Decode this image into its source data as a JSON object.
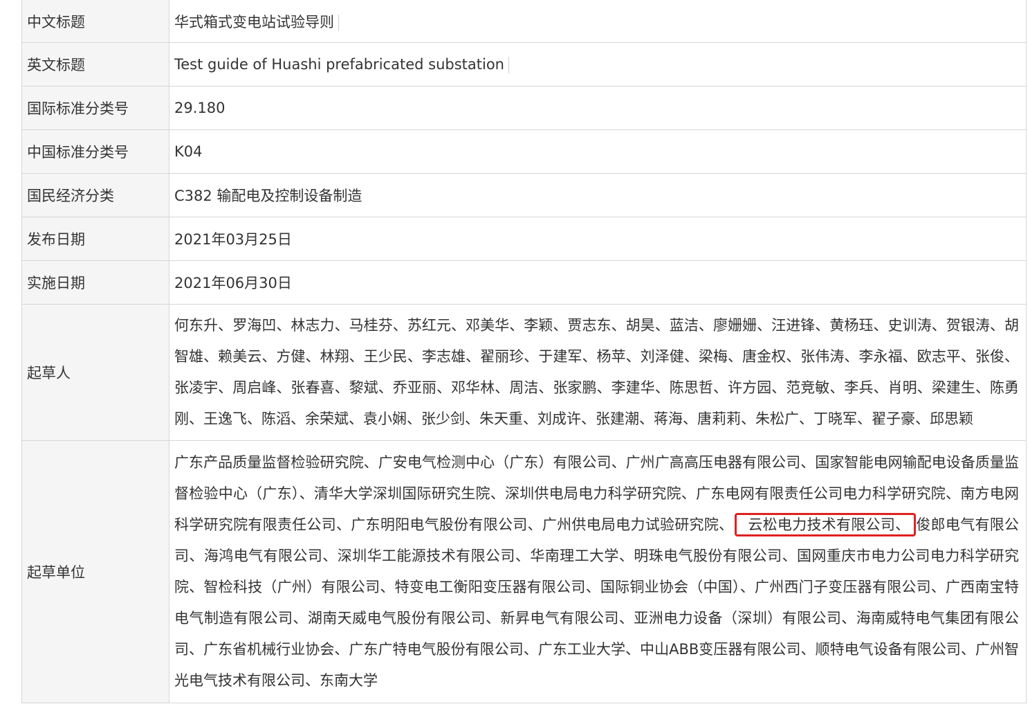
{
  "rows": [
    {
      "label": "中文标题",
      "value": "华式箱式变电站试验导则"
    },
    {
      "label": "英文标题",
      "value": "Test guide of Huashi prefabricated substation"
    },
    {
      "label": "国际标准分类号",
      "value": "29.180"
    },
    {
      "label": "中国标准分类号",
      "value": "K04"
    },
    {
      "label": "国民经济分类",
      "value": "C382 输配电及控制设备制造"
    },
    {
      "label": "发布日期",
      "value": "2021年03月25日"
    },
    {
      "label": "实施日期",
      "value": "2021年06月30日"
    }
  ],
  "drafters": {
    "label": "起草人",
    "value": "何东升、罗海凹、林志力、马桂芬、苏红元、邓美华、李颖、贾志东、胡昊、蓝洁、廖姗姗、汪进锋、黄杨珏、史训涛、贺银涛、胡智雄、赖美云、方健、林翔、王少民、李志雄、翟丽珍、于建军、杨苹、刘泽健、梁梅、唐金权、张伟涛、李永福、欧志平、张俊、张凌宇、周启峰、张春喜、黎斌、乔亚丽、邓华林、周洁、张家鹏、李建华、陈思哲、许方园、范竞敏、李兵、肖明、梁建生、陈勇刚、王逸飞、陈滔、余荣斌、袁小娴、张少剑、朱天重、刘成许、张建潮、蒋海、唐莉莉、朱松广、丁晓军、翟子豪、邱思颖"
  },
  "units": {
    "label": "起草单位",
    "before": "广东产品质量监督检验研究院、广安电气检测中心（广东）有限公司、广州广高高压电器有限公司、国家智能电网输配电设备质量监督检验中心（广东）、清华大学深圳国际研究生院、深圳供电局电力科学研究院、广东电网有限责任公司电力科学研究院、南方电网科学研究院有限责任公司、广东明阳电气股份有限公司、广州供电局电力试验研究院、",
    "highlight": "云松电力技术有限公司、",
    "after": "俊郎电气有限公司、海鸿电气有限公司、深圳华工能源技术有限公司、华南理工大学、明珠电气股份有限公司、国网重庆市电力公司电力科学研究院、智检科技（广州）有限公司、特变电工衡阳变压器有限公司、国际铜业协会（中国）、广州西门子变压器有限公司、广西南宝特电气制造有限公司、湖南天威电气股份有限公司、新昇电气有限公司、亚洲电力设备（深圳）有限公司、海南威特电气集团有限公司、广东省机械行业协会、广东广特电气股份有限公司、广东工业大学、中山ABB变压器有限公司、顺特电气设备有限公司、广州智光电气技术有限公司、东南大学"
  },
  "colors": {
    "highlight_border": "#e02020",
    "label_background": "#f5f5f5",
    "border": "#d6d6d6"
  }
}
